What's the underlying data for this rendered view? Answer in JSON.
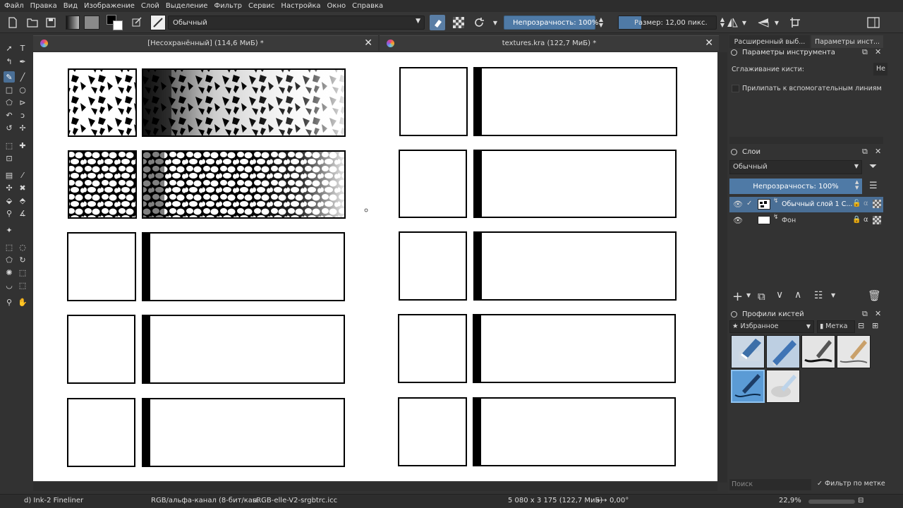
{
  "menu": [
    "Файл",
    "Правка",
    "Вид",
    "Изображение",
    "Слой",
    "Выделение",
    "Фильтр",
    "Сервис",
    "Настройка",
    "Окно",
    "Справка"
  ],
  "toolbar": {
    "blend_mode": "Обычный",
    "opacity": "Непрозрачность: 100%",
    "size": "Размер: 12,00 пикс."
  },
  "tabs": [
    {
      "title": "[Несохранённый]  (114,6 МиБ) *",
      "close": "✕"
    },
    {
      "title": "textures.kra  (122,7 МиБ) *",
      "close": "✕"
    }
  ],
  "dock_tabs": [
    "Расширенный выб...",
    "Параметры инст..."
  ],
  "tool_options": {
    "title": "Параметры инструмента",
    "smoothing_label": "Сглаживание кисти:",
    "smoothing_value": "Не",
    "snap_label": "Прилипать к вспомогательным линиям"
  },
  "layers": {
    "title": "Слои",
    "blend_mode": "Обычный",
    "opacity": "Непрозрачность:  100%",
    "items": [
      {
        "name": "Обычный слой 1 С...",
        "visible": true,
        "selected": true
      },
      {
        "name": "Фон",
        "visible": true,
        "selected": false,
        "locked": true
      }
    ]
  },
  "brushes": {
    "title": "Профили кистей",
    "filter": "★ Избранное",
    "tag": "Метка",
    "search_placeholder": "Поиск",
    "filter_by_tag": "Фильтр по метке"
  },
  "status": {
    "brush": "d) Ink-2 Fineliner",
    "color_model": "RGB/альфа-канал (8-бит/кан...",
    "profile": "sRGB-elle-V2-srgbtrc.icc",
    "dimensions": "5 080 x 3 175 (122,7 МиБ)",
    "rotation": "0,00°",
    "zoom": "22,9%"
  },
  "colors": {
    "accent": "#4f7aa6",
    "bg": "#323232",
    "canvas": "#ffffff"
  }
}
